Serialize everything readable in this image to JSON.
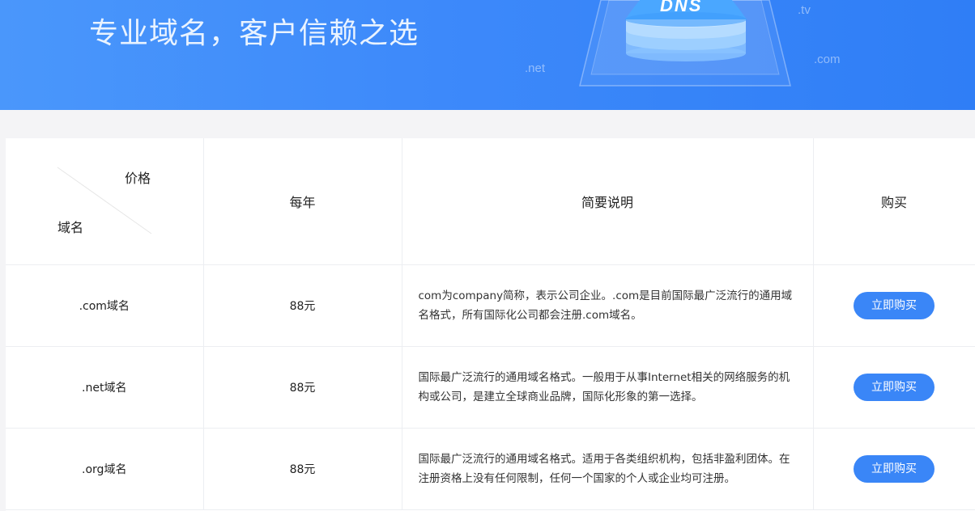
{
  "banner": {
    "title": "专业域名，客户信赖之选",
    "graphic_text": "DNS",
    "tld_labels": [
      ".tv",
      ".com",
      ".net"
    ]
  },
  "table": {
    "corner_top": "价格",
    "corner_bottom": "域名",
    "headers": [
      "每年",
      "简要说明",
      "购买"
    ],
    "rows": [
      {
        "domain": ".com域名",
        "price": "88元",
        "desc": "com为company简称，表示公司企业。.com是目前国际最广泛流行的通用域名格式，所有国际化公司都会注册.com域名。",
        "button": "立即购买"
      },
      {
        "domain": ".net域名",
        "price": "88元",
        "desc": "国际最广泛流行的通用域名格式。一般用于从事Internet相关的网络服务的机构或公司，是建立全球商业品牌，国际化形象的第一选择。",
        "button": "立即购买"
      },
      {
        "domain": ".org域名",
        "price": "88元",
        "desc": "国际最广泛流行的通用域名格式。适用于各类组织机构，包括非盈利团体。在注册资格上没有任何限制，任何一个国家的个人或企业均可注册。",
        "button": "立即购买"
      }
    ]
  }
}
